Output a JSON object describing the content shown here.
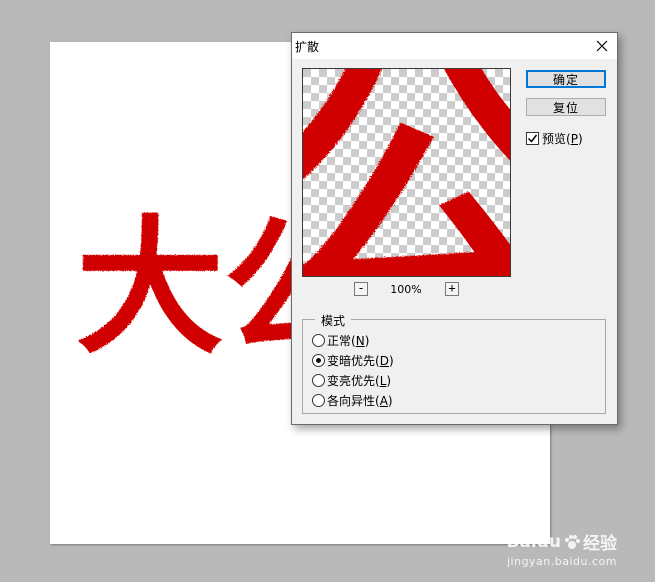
{
  "dialog": {
    "title": "扩散",
    "ok_label": "确定",
    "reset_label": "复位",
    "preview_label": "预览",
    "preview_key": "P",
    "preview_checked": true,
    "zoom_out_label": "-",
    "zoom_in_label": "+",
    "zoom_level": "100%",
    "mode_group": {
      "legend": "模式",
      "options": [
        {
          "label": "正常",
          "key": "N",
          "selected": false
        },
        {
          "label": "变暗优先",
          "key": "D",
          "selected": true
        },
        {
          "label": "变亮优先",
          "key": "L",
          "selected": false
        },
        {
          "label": "各向异性",
          "key": "A",
          "selected": false
        }
      ]
    }
  },
  "canvas": {
    "text": "大公",
    "text_color": "#d10000"
  },
  "preview": {
    "glyph": "公",
    "fill_color": "#d10000"
  },
  "watermark": {
    "brand": "Baidu",
    "brand_suffix": "经验",
    "url": "jingyan.baidu.com"
  }
}
